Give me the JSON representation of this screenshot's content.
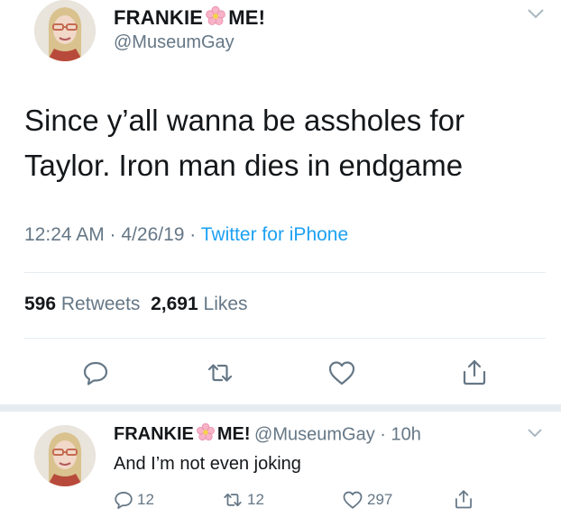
{
  "tweet": {
    "display_name_left": "FRANKIE",
    "display_name_right": "ME!",
    "handle": "@MuseumGay",
    "text": "Since y’all wanna be assholes for Taylor. Iron man dies in endgame",
    "time": "12:24 AM · 4/26/19 · ",
    "source": "Twitter for iPhone",
    "retweets_count": "596",
    "retweets_label": "Retweets",
    "likes_count": "2,691",
    "likes_label": "Likes"
  },
  "reply": {
    "display_name_left": "FRANKIE",
    "display_name_right": "ME!",
    "handle_time": "@MuseumGay · 10h",
    "text": "And I’m not even joking",
    "reply_count": "12",
    "retweet_count": "12",
    "like_count": "297"
  },
  "icons": {
    "flower": "cherry-blossom-emoji",
    "chevron": "chevron-down-icon",
    "reply": "reply-icon",
    "retweet": "retweet-icon",
    "like": "heart-icon",
    "share": "share-icon"
  },
  "colors": {
    "accent": "#1da1f2",
    "secondary_text": "#657786",
    "divider": "#e6ecf0"
  }
}
